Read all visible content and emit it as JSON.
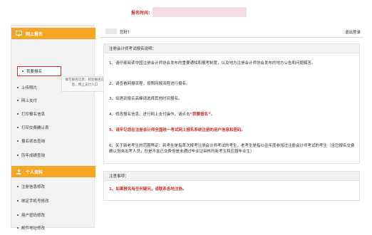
{
  "top": {
    "time_label": "报名时间："
  },
  "sidebar": {
    "online_title": "网上报名",
    "online_items": [
      "我要报名",
      "上传照片",
      "网上支付",
      "打印报名信息",
      "打印交费确认表",
      "报名状态查询",
      "历年成绩查询"
    ],
    "tooltip": "填写报名信息，校验报名信息，网上支付入口",
    "personal_title": "个人资料",
    "personal_items": [
      "注册信息修改",
      "绑定手机号修改",
      "用户密码修改",
      "邮件地址修改"
    ]
  },
  "main": {
    "greeting": "您好！",
    "logout": "退出登录",
    "notice_title": "注册会计师考试报名说明：",
    "items": [
      "1、请仔细阅读中国注册会计师协会发布的重要通知和报考制度，以及地方注册会计师协会发布的地方公告和问题解答。",
      "2、请查看网报流程，按照网报流程进行报名。",
      "3、如遇到报名高峰请选择其他时间报名。",
      "4、修改报名信息、进行网上支付操作，请点击",
      "5、请牢记您在注册会计师全国统一考试网上报名系统注册的用户信息和密码。",
      "6、关于新老考生的范围界定：新考生是指首次报考注册会计师考试的考生，老考生是指以往年度参加过注册会计师考试的考生（含已报名交费确认但未出考人员，但是不含已交费但是未通过毕业证审核的新考生和应届毕业生）"
    ],
    "item4_highlight": "“我要报名”",
    "item4_tail": "。",
    "attention_title": "注意事项：",
    "attention_text": "1、如果报名有任何疑问，请联系各地注协。"
  }
}
